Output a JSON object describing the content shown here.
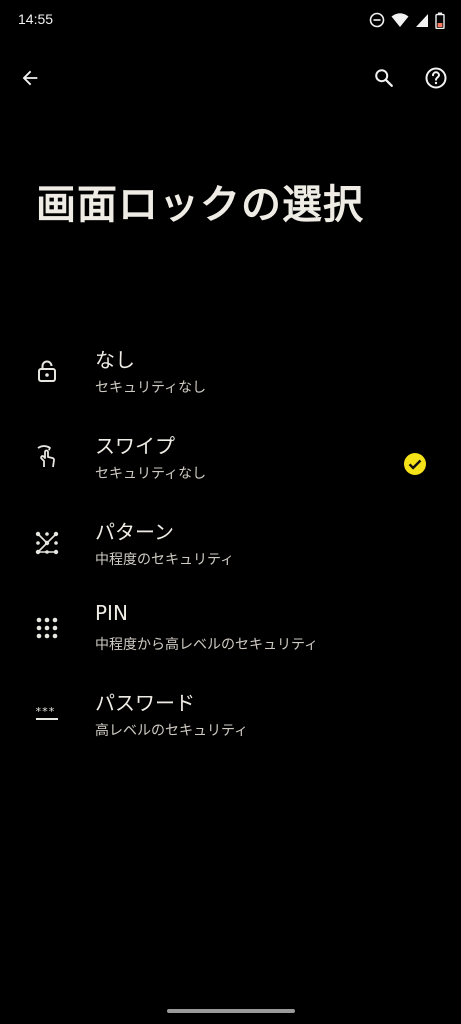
{
  "status_bar": {
    "time": "14:55"
  },
  "header": {
    "title": "画面ロックの選択"
  },
  "options": [
    {
      "title": "なし",
      "subtitle": "セキュリティなし",
      "icon": "lock-open-icon",
      "selected": false
    },
    {
      "title": "スワイプ",
      "subtitle": "セキュリティなし",
      "icon": "swipe-icon",
      "selected": true
    },
    {
      "title": "パターン",
      "subtitle": "中程度のセキュリティ",
      "icon": "pattern-icon",
      "selected": false
    },
    {
      "title": "PIN",
      "subtitle": "中程度から高レベルのセキュリティ",
      "icon": "pin-icon",
      "selected": false
    },
    {
      "title": "パスワード",
      "subtitle": "高レベルのセキュリティ",
      "icon": "password-icon",
      "selected": false
    }
  ],
  "colors": {
    "background": "#000000",
    "text": "#efece5",
    "check": "#f5e31a"
  }
}
